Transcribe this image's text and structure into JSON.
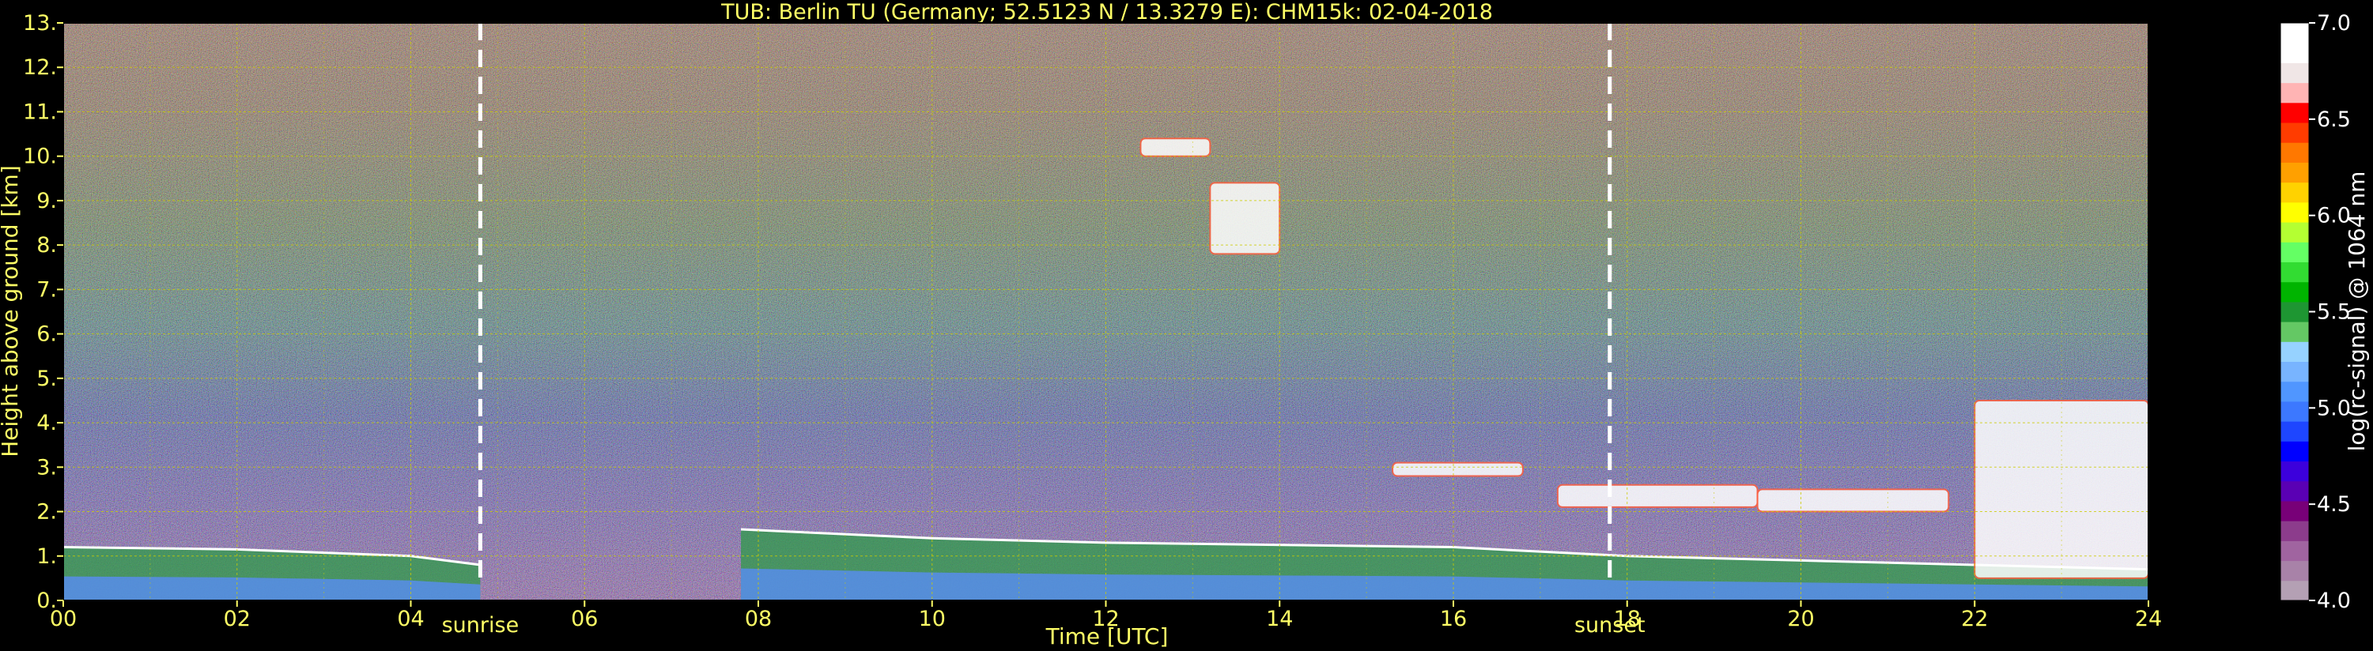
{
  "chart_data": {
    "type": "heatmap",
    "title": "TUB: Berlin TU (Germany; 52.5123 N / 13.3279 E):    CHM15k: 02-04-2018",
    "xlabel": "Time [UTC]",
    "ylabel": "Height above ground [km]",
    "xlim": [
      0,
      24
    ],
    "ylim": [
      0,
      13
    ],
    "x_ticks": [
      0,
      2,
      4,
      6,
      8,
      10,
      12,
      14,
      16,
      18,
      20,
      22,
      24
    ],
    "x_tick_labels": [
      "00",
      "02",
      "04",
      "06",
      "08",
      "10",
      "12",
      "14",
      "16",
      "18",
      "20",
      "22",
      "24"
    ],
    "y_ticks": [
      0,
      1,
      2,
      3,
      4,
      5,
      6,
      7,
      8,
      9,
      10,
      11,
      12,
      13
    ],
    "y_tick_labels": [
      "0.",
      "1.",
      "2.",
      "3.",
      "4.",
      "5.",
      "6.",
      "7.",
      "8.",
      "9.",
      "10.",
      "11.",
      "12.",
      "13."
    ],
    "grid": true,
    "grid_color": "#cccc00",
    "annotations": [
      {
        "label": "sunrise",
        "x": 4.8
      },
      {
        "label": "sunset",
        "x": 17.8
      }
    ],
    "colorbar": {
      "label": "log(rc-signal) @ 1064 nm",
      "range": [
        4.0,
        7.0
      ],
      "ticks": [
        4.0,
        4.5,
        5.0,
        5.5,
        6.0,
        6.5,
        7.0
      ],
      "tick_labels": [
        "4.0",
        "4.5",
        "5.0",
        "5.5",
        "6.0",
        "6.5",
        "7.0"
      ],
      "colors": [
        "#b4a0b4",
        "#a882a8",
        "#a064a0",
        "#8c3c8c",
        "#780078",
        "#5a00b4",
        "#3c00dc",
        "#0000ff",
        "#1e46ff",
        "#3c78ff",
        "#5096ff",
        "#78b4ff",
        "#96d2ff",
        "#64c864",
        "#1e9632",
        "#00b400",
        "#32dc32",
        "#64ff64",
        "#b4ff32",
        "#ffff00",
        "#ffd200",
        "#ffa000",
        "#ff7800",
        "#ff3c00",
        "#ff0000",
        "#ffb4b4",
        "#f0e6e6",
        "#ffffff",
        "#ffffff"
      ]
    },
    "features": [
      {
        "type": "boundary_layer_top",
        "points": [
          [
            0,
            1.2
          ],
          [
            2,
            1.15
          ],
          [
            4,
            1.0
          ],
          [
            4.8,
            0.8
          ]
        ]
      },
      {
        "type": "boundary_layer_top",
        "points": [
          [
            7.8,
            1.6
          ],
          [
            10,
            1.4
          ],
          [
            12,
            1.3
          ],
          [
            16,
            1.2
          ],
          [
            18,
            1.0
          ],
          [
            20,
            0.9
          ],
          [
            22,
            0.8
          ],
          [
            24,
            0.7
          ]
        ]
      },
      {
        "type": "cloud",
        "x_range": [
          12.4,
          13.2
        ],
        "y_range": [
          10.0,
          10.4
        ]
      },
      {
        "type": "cloud",
        "x_range": [
          13.2,
          14.0
        ],
        "y_range": [
          7.8,
          9.4
        ]
      },
      {
        "type": "cloud",
        "x_range": [
          15.3,
          16.8
        ],
        "y_range": [
          2.8,
          3.1
        ]
      },
      {
        "type": "cloud",
        "x_range": [
          17.2,
          19.5
        ],
        "y_range": [
          2.1,
          2.6
        ]
      },
      {
        "type": "cloud",
        "x_range": [
          19.5,
          21.7
        ],
        "y_range": [
          2.0,
          2.5
        ]
      },
      {
        "type": "cloud",
        "x_range": [
          22.0,
          24.0
        ],
        "y_range": [
          0.5,
          4.5
        ]
      }
    ]
  }
}
